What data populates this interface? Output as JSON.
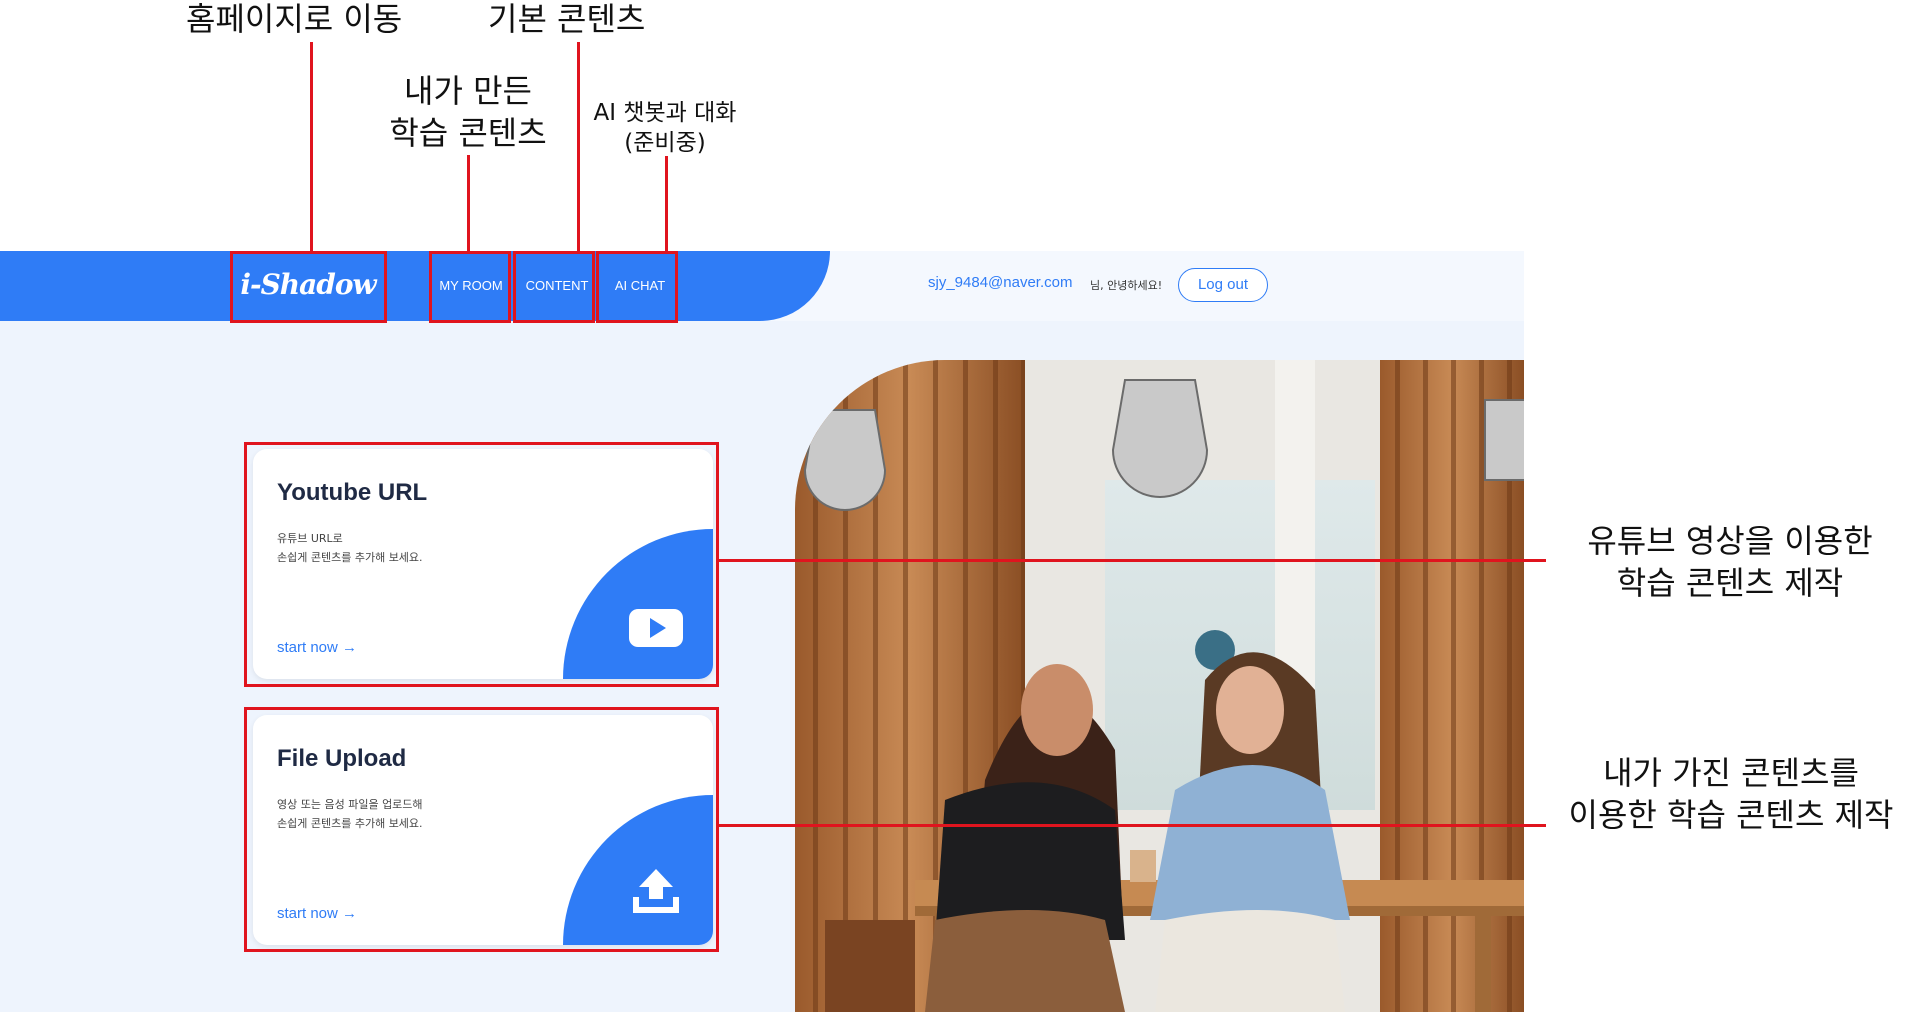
{
  "annotations": {
    "home": "홈페이지로 이동",
    "basic_content": "기본 콘텐츠",
    "my_content_line1": "내가 만든",
    "my_content_line2": "학습 콘텐츠",
    "ai_chat_line1": "AI 챗봇과 대화",
    "ai_chat_line2": "(준비중)",
    "youtube_line1": "유튜브 영상을 이용한",
    "youtube_line2": "학습 콘텐츠 제작",
    "upload_line1": "내가 가진 콘텐츠를",
    "upload_line2": "이용한 학습 콘텐츠 제작"
  },
  "header": {
    "logo": "i-Shadow",
    "nav": [
      "MY ROOM",
      "CONTENT",
      "AI CHAT"
    ],
    "user_email": "sjy_9484@naver.com",
    "greeting": "님, 안녕하세요!",
    "logout_label": "Log out"
  },
  "cards": [
    {
      "title": "Youtube URL",
      "desc_line1": "유튜브 URL로",
      "desc_line2": "손쉽게 콘텐츠를 추가해 보세요.",
      "link": "start now →",
      "icon": "play-icon"
    },
    {
      "title": "File Upload",
      "desc_line1": "영상 또는 음성 파일을 업로드해",
      "desc_line2": "손쉽게 콘텐츠를 추가해 보세요.",
      "link": "start now →",
      "icon": "upload-icon"
    }
  ],
  "colors": {
    "accent": "#2f7cf6",
    "background": "#eef4fd",
    "annotation": "#e0141e"
  }
}
